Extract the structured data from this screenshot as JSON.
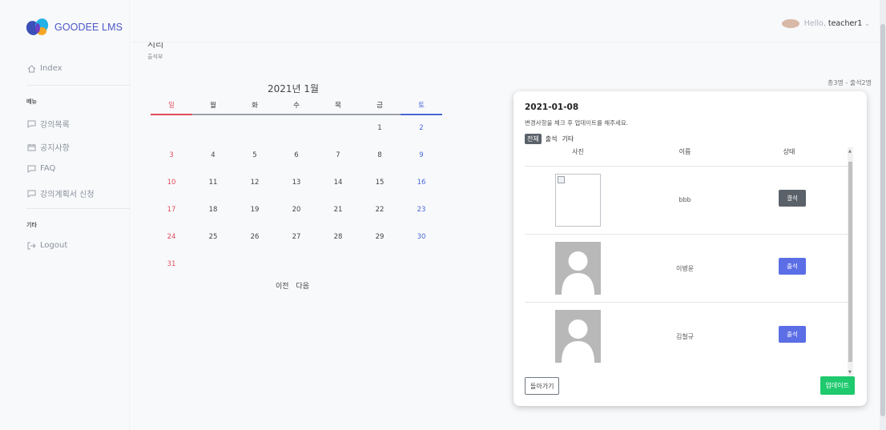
{
  "brand": {
    "name": "GOODEE LMS"
  },
  "header": {
    "hello": "Hello,",
    "username": "teacher1",
    "chevron": "chevron-down-icon"
  },
  "sidebar": {
    "index_label": "Index",
    "menu_head": "메뉴",
    "items": [
      {
        "label": "강의목록",
        "icon": "chat-bubble-icon"
      },
      {
        "label": "공지사항",
        "icon": "calendar-icon"
      },
      {
        "label": "FAQ",
        "icon": "chat-bubble-icon"
      },
      {
        "label": "강의계획서 신청",
        "icon": "chat-bubble-icon"
      }
    ],
    "etc_head": "기타",
    "logout_label": "Logout"
  },
  "page": {
    "title": "시리",
    "subtitle": "출석부",
    "summary": "총3명 - 출석2명"
  },
  "calendar": {
    "title": "2021년 1월",
    "weekdays": [
      "일",
      "월",
      "화",
      "수",
      "목",
      "금",
      "토"
    ],
    "weeks": [
      [
        "",
        "",
        "",
        "",
        "",
        "1",
        "2"
      ],
      [
        "3",
        "4",
        "5",
        "6",
        "7",
        "8",
        "9"
      ],
      [
        "10",
        "11",
        "12",
        "13",
        "14",
        "15",
        "16"
      ],
      [
        "17",
        "18",
        "19",
        "20",
        "21",
        "22",
        "23"
      ],
      [
        "24",
        "25",
        "26",
        "27",
        "28",
        "29",
        "30"
      ],
      [
        "31",
        "",
        "",
        "",
        "",
        "",
        ""
      ]
    ],
    "prev_label": "이전",
    "next_label": "다음",
    "colors": {
      "sunday": "#e24c5b",
      "saturday": "#4a67d6"
    }
  },
  "modal": {
    "date": "2021-01-08",
    "note": "변경사항을 체크 후 업데이트를 해주세요.",
    "filters": [
      "전체",
      "출석",
      "기타"
    ],
    "columns": [
      "사진",
      "이름",
      "상태"
    ],
    "rows": [
      {
        "photo": "broken-image",
        "name": "bbb",
        "status": "결석"
      },
      {
        "photo": "default-avatar",
        "name": "이병윤",
        "status": "출석"
      },
      {
        "photo": "default-avatar",
        "name": "김철규",
        "status": "출석"
      }
    ],
    "back_label": "돌아가기",
    "update_label": "업데이트",
    "colors": {
      "absent": "#5a6169",
      "present": "#5b6ee6",
      "update": "#1fc96e"
    }
  }
}
